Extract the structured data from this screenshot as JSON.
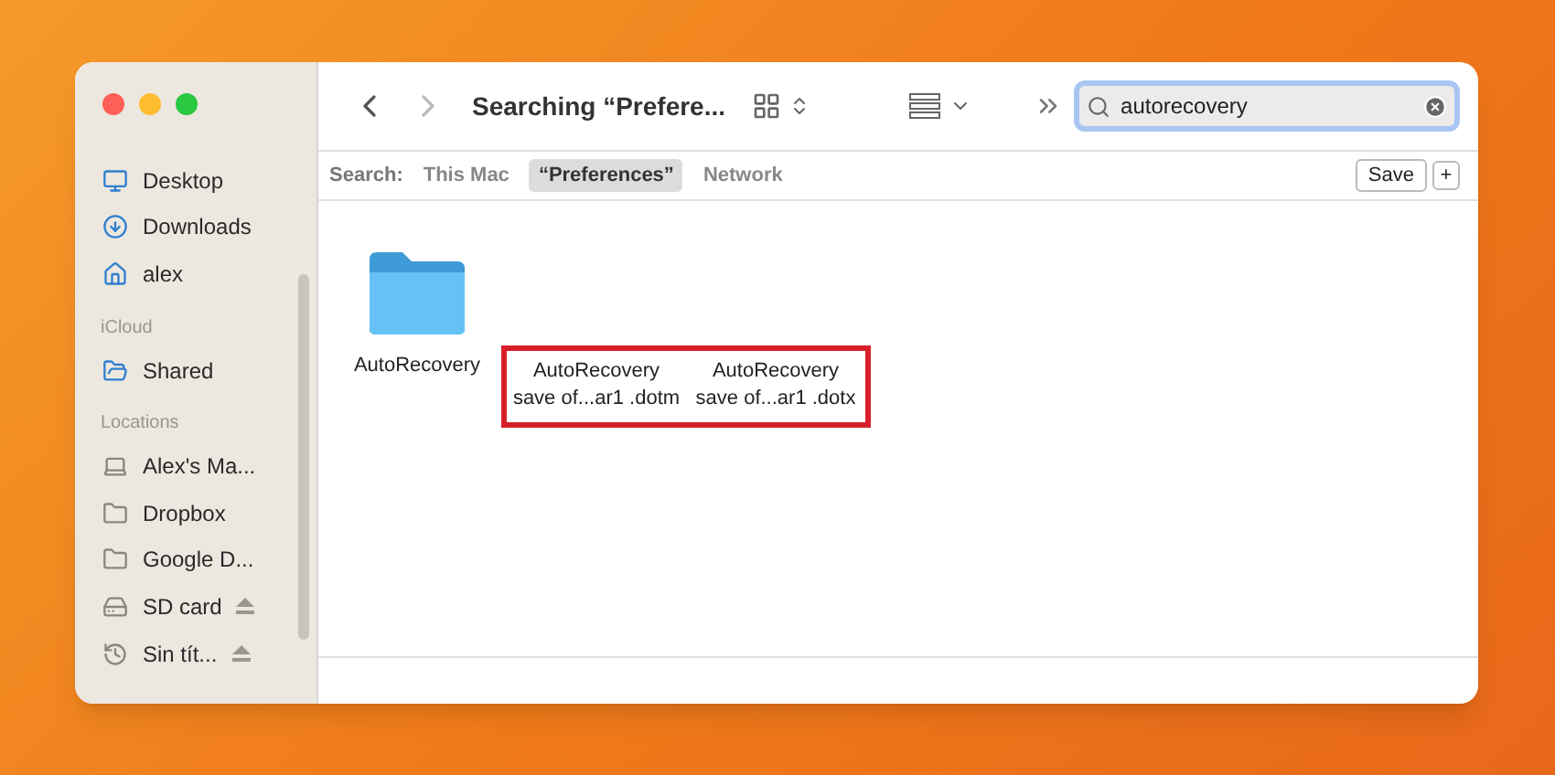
{
  "window": {
    "title": "Searching “Prefere..."
  },
  "sidebar": {
    "sections": [
      {
        "items": [
          {
            "label": "Desktop",
            "kind": "desktop",
            "ejectable": false
          },
          {
            "label": "Downloads",
            "kind": "download",
            "ejectable": false
          },
          {
            "label": "alex",
            "kind": "home",
            "ejectable": false
          }
        ]
      },
      {
        "heading": "iCloud",
        "items": [
          {
            "label": "Shared",
            "kind": "shared",
            "ejectable": false
          }
        ]
      },
      {
        "heading": "Locations",
        "items": [
          {
            "label": "Alex's Ma...",
            "kind": "computer",
            "ejectable": false
          },
          {
            "label": "Dropbox",
            "kind": "folder",
            "ejectable": false
          },
          {
            "label": "Google D...",
            "kind": "folder",
            "ejectable": false
          },
          {
            "label": "SD card",
            "kind": "drive",
            "ejectable": true
          },
          {
            "label": "Sin tít...",
            "kind": "clock",
            "ejectable": true
          }
        ]
      }
    ]
  },
  "search": {
    "value": "autorecovery"
  },
  "scope_bar": {
    "label": "Search:",
    "scopes": [
      {
        "label": "This Mac",
        "selected": false
      },
      {
        "label": "“Preferences”",
        "selected": true
      },
      {
        "label": "Network",
        "selected": false
      }
    ],
    "save": "Save",
    "add": "+"
  },
  "files": [
    {
      "kind": "folder",
      "lines": [
        "AutoRecovery"
      ],
      "highlighted": false
    },
    {
      "kind": "document",
      "lines": [
        "AutoRecovery",
        "save of...ar1 .dotm"
      ],
      "highlighted": true
    },
    {
      "kind": "document",
      "lines": [
        "AutoRecovery",
        "save of...ar1 .dotx"
      ],
      "highlighted": true
    }
  ]
}
